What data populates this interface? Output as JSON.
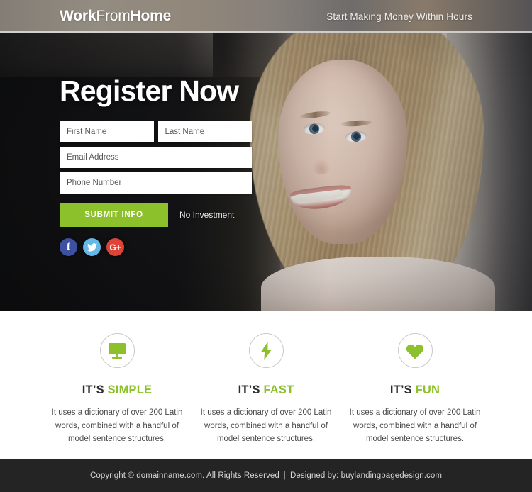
{
  "header": {
    "logo_bold_1": "Work",
    "logo_light": "From",
    "logo_bold_2": "Home",
    "tagline": "Start Making Money Within Hours"
  },
  "hero": {
    "title": "Register Now",
    "form": {
      "first_name_placeholder": "First Name",
      "first_name_value": "",
      "last_name_placeholder": "Last Name",
      "last_name_value": "",
      "email_placeholder": "Email Address",
      "email_value": "",
      "phone_placeholder": "Phone Number",
      "phone_value": "",
      "submit_label": "SUBMIT INFO",
      "note": "No Investment"
    },
    "socials": [
      {
        "name": "facebook",
        "glyph": "f",
        "color": "#3d51a0"
      },
      {
        "name": "twitter",
        "glyph": "ᵛ",
        "color": "#63b9e8"
      },
      {
        "name": "google-plus",
        "glyph": "G+",
        "color": "#dc4437"
      }
    ]
  },
  "features": [
    {
      "icon": "monitor-icon",
      "title_prefix": "IT’S ",
      "title_accent": "SIMPLE",
      "description": "It uses a dictionary of over 200 Latin words, combined with a handful of model sentence structures."
    },
    {
      "icon": "lightning-bolt-icon",
      "title_prefix": "IT’S ",
      "title_accent": "FAST",
      "description": "It uses a dictionary of over 200 Latin words, combined with a handful of model sentence structures."
    },
    {
      "icon": "heart-icon",
      "title_prefix": "IT’S ",
      "title_accent": "FUN",
      "description": "It uses a dictionary of over 200 Latin words, combined with a handful of model sentence structures."
    }
  ],
  "footer": {
    "copyright": "Copyright © domainname.com. All Rights Reserved",
    "separator": "|",
    "designed_by": "Designed by: buylandingpagedesign.com"
  },
  "colors": {
    "accent_green": "#8cc12c",
    "footer_bg": "#242424",
    "text_dark": "#2d2d2d"
  }
}
